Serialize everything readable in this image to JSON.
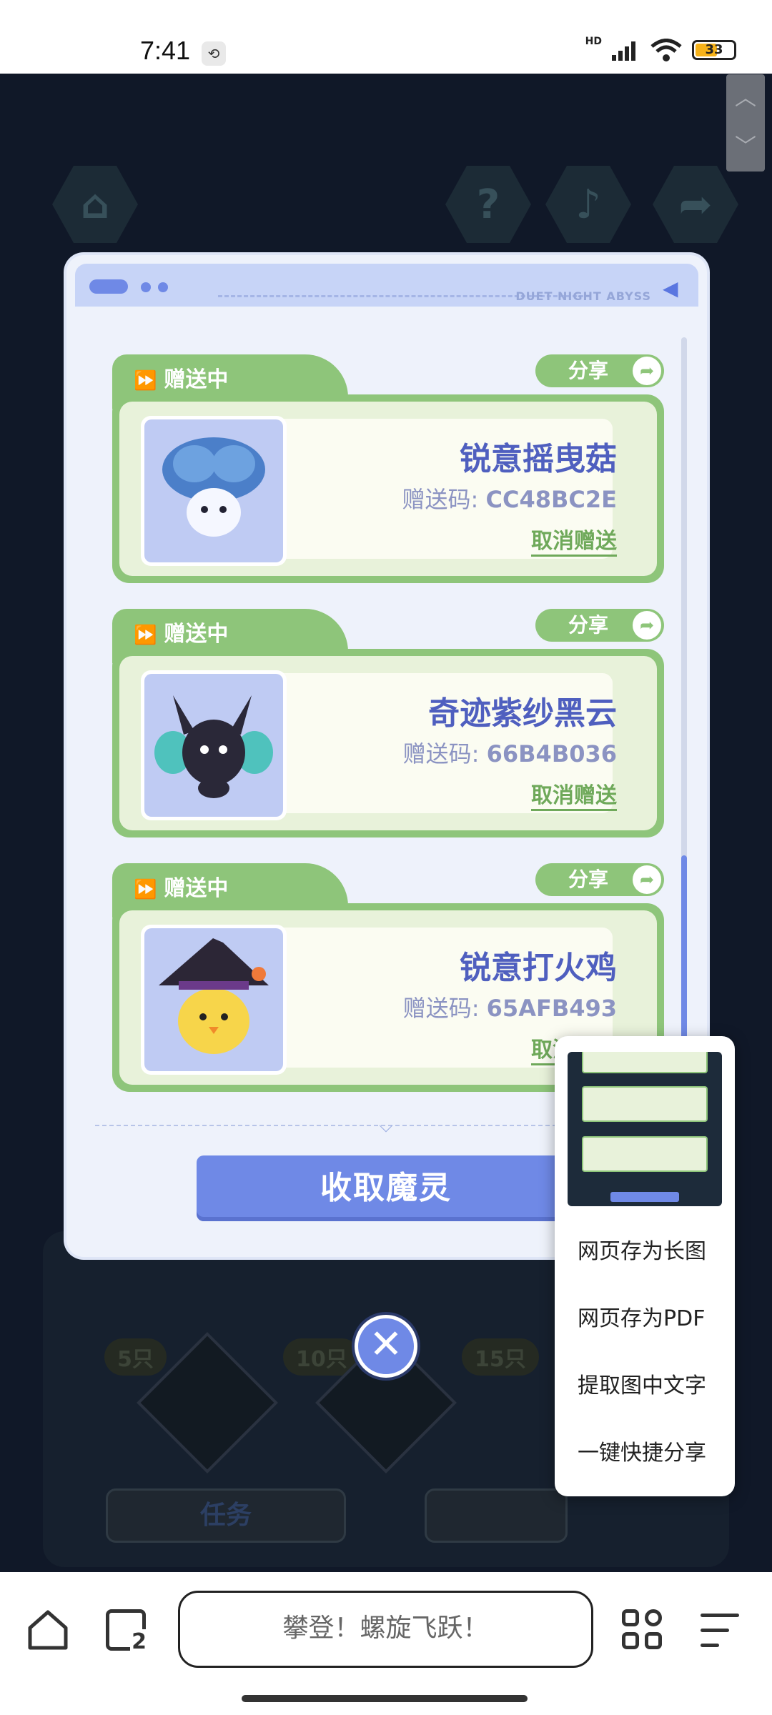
{
  "status_bar": {
    "time": "7:41",
    "network": "HD",
    "battery": "33",
    "icons": [
      "sync-icon",
      "signal-icon",
      "wifi-icon",
      "battery-icon"
    ]
  },
  "dialog": {
    "header_brand": "DUET NIGHT ABYSS",
    "cards": [
      {
        "status": "赠送中",
        "share_label": "分享",
        "name": "锐意摇曳菇",
        "code_label": "赠送码:",
        "code": "CC48BC2E",
        "cancel_label": "取消赠送"
      },
      {
        "status": "赠送中",
        "share_label": "分享",
        "name": "奇迹紫纱黑云",
        "code_label": "赠送码:",
        "code": "66B4B036",
        "cancel_label": "取消赠送"
      },
      {
        "status": "赠送中",
        "share_label": "分享",
        "name": "锐意打火鸡",
        "code_label": "赠送码:",
        "code": "65AFB493",
        "cancel_label": "取消赠送"
      }
    ],
    "collect_button": "收取魔灵"
  },
  "context_menu": {
    "items": [
      "网页存为长图",
      "网页存为PDF",
      "提取图中文字",
      "一键快捷分享"
    ]
  },
  "background": {
    "tags": [
      "5只",
      "10只",
      "15只"
    ],
    "task_button": "任务"
  },
  "bottom_bar": {
    "search_text": "攀登！螺旋飞跃！",
    "tab_count": "2"
  },
  "colors": {
    "accent_blue": "#6f89e6",
    "card_green": "#8ec57a",
    "name_text": "#4f5fbf"
  }
}
